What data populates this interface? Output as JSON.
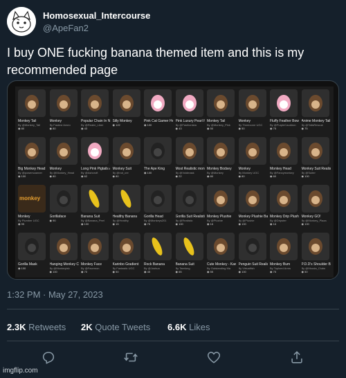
{
  "author": {
    "display_name": "Homosexual_Intercourse",
    "handle": "@ApeFan2"
  },
  "tweet": {
    "text": "I buy ONE fucking banana themed item and this is my recommended page",
    "timestamp": "1:32 PM · May 27, 2023"
  },
  "stats": {
    "retweets_count": "2.3K",
    "retweets_label": "Retweets",
    "quotes_count": "2K",
    "quotes_label": "Quote Tweets",
    "likes_count": "6.6K",
    "likes_label": "Likes"
  },
  "icons": {
    "reply": "reply-icon",
    "retweet": "retweet-icon",
    "like": "heart-icon",
    "share": "share-icon"
  },
  "colors": {
    "background": "#15202b",
    "secondary_text": "#8899a6",
    "divider": "#38444d"
  },
  "media": {
    "rows": [
      [
        {
          "name": "Monkey Tail",
          "by": "By @Monkey_Tail",
          "price": "80"
        },
        {
          "name": "Monkey",
          "by": "By Fastest Ameo",
          "price": "80"
        },
        {
          "name": "Popular Chain In Nose",
          "by": "By @Realm_Liker",
          "price": "43"
        },
        {
          "name": "Silly Monkey",
          "by": "",
          "price": "122"
        },
        {
          "name": "Pink Cat Gamer Headphones",
          "by": "",
          "price": "100"
        },
        {
          "name": "Pink Luxury Pearl Purse",
          "by": "By @Fashionista",
          "price": "43"
        },
        {
          "name": "Monkey Tail",
          "by": "By @Monkey_Pink",
          "price": "50"
        },
        {
          "name": "Monkey",
          "by": "By Threezone UGC",
          "price": "50"
        },
        {
          "name": "Fluffy Feather Bow Pink 2.0",
          "by": "By @PurpleCauldron",
          "price": "75"
        },
        {
          "name": "Anime Monkey Tail",
          "by": "By @TailsRescue",
          "price": "75"
        }
      ],
      [
        {
          "name": "Big Monkey Head",
          "by": "By @powerscanner",
          "price": "100"
        },
        {
          "name": "Monkey",
          "by": "By @Monkey_Head",
          "price": "80"
        },
        {
          "name": "Long Pink Pigtails Adorable",
          "by": "By @Ashcroft",
          "price": "62"
        },
        {
          "name": "Monkey Suit",
          "by": "By @not_cre",
          "price": "80"
        },
        {
          "name": "The Ape King",
          "by": "",
          "price": "100"
        },
        {
          "name": "Most Realistic monkey mask",
          "by": "By @Voidmask",
          "price": "22"
        },
        {
          "name": "Monkey Bodsey",
          "by": "By @Monkey",
          "price": "80"
        },
        {
          "name": "Monkey",
          "by": "By Monkey UGC",
          "price": "80"
        },
        {
          "name": "Monkey Head",
          "by": "By @Fancymonkey",
          "price": "60"
        },
        {
          "name": "Monkey Suit Realistic",
          "by": "By @Suiter",
          "price": "100"
        }
      ],
      [
        {
          "name": "Monkey",
          "by": "By Plumber UGC",
          "price": "95"
        },
        {
          "name": "Gorillaface",
          "by": "",
          "price": "90"
        },
        {
          "name": "Banana Suit",
          "by": "By @Banana_Peel",
          "price": "100"
        },
        {
          "name": "Healthy Banana",
          "by": "By @Healthy",
          "price": "15"
        },
        {
          "name": "Gorilla Head",
          "by": "By @Monkeys201",
          "price": "75"
        },
        {
          "name": "Gorilla Suit Realistic Monkey",
          "by": "By @Realistic",
          "price": "100"
        },
        {
          "name": "Monkey Plushie",
          "by": "By @Plushie",
          "price": "16"
        },
        {
          "name": "Monkey Plushie Back Pack 1.0",
          "by": "By @Plushie",
          "price": "100"
        },
        {
          "name": "Monkey Drip Plushie",
          "by": "By @Dripster",
          "price": "16"
        },
        {
          "name": "Monkey GO!",
          "by": "By @Monkey_Plaza",
          "price": "100"
        }
      ],
      [
        {
          "name": "Gorilla Mask",
          "by": "",
          "price": "100"
        },
        {
          "name": "Hanging Monkey Companion (1.0)",
          "by": "By @Monkeylab",
          "price": "100"
        },
        {
          "name": "Monkey Face",
          "by": "By @Facemon",
          "price": "70"
        },
        {
          "name": "Karinbo Gradient",
          "by": "By Fantastic UGC",
          "price": "50"
        },
        {
          "name": "Rock Banana",
          "by": "By @Joshua",
          "price": "45"
        },
        {
          "name": "Banana Suit",
          "by": "By Tarelong",
          "price": "65"
        },
        {
          "name": "Cute Monkey - Kawaii Anime",
          "by": "By Outstanding Ma",
          "price": "55"
        },
        {
          "name": "Penguin Suit Realistic",
          "by": "By Virtualfish",
          "price": "100"
        },
        {
          "name": "Monkey Bum",
          "by": "By Toploed Arms",
          "price": "75"
        },
        {
          "name": "P.D.D's Shoulder Buddy",
          "by": "By @Mooda_Clubs",
          "price": "50"
        }
      ]
    ]
  }
}
